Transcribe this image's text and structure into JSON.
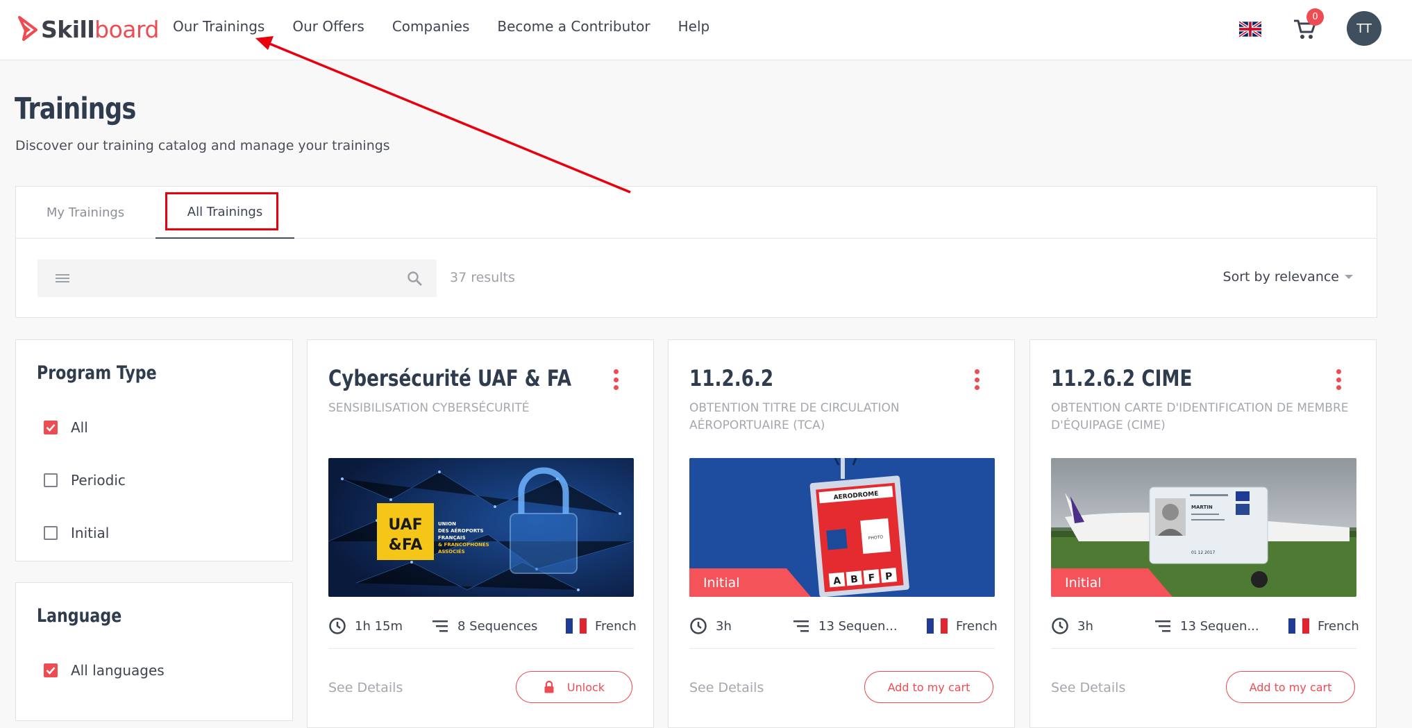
{
  "brand": {
    "name_strong": "Skill",
    "name_light": "board",
    "accent_color": "#ef4b52"
  },
  "nav": {
    "items": [
      "Our Trainings",
      "Our Offers",
      "Companies",
      "Become a Contributor",
      "Help"
    ]
  },
  "header": {
    "language_icon": "uk-flag-icon",
    "cart_count": "0",
    "avatar_initials": "TT"
  },
  "page": {
    "title": "Trainings",
    "subtitle": "Discover our training catalog and manage your trainings"
  },
  "tabs": {
    "my": "My Trainings",
    "all": "All Trainings",
    "active": "all"
  },
  "search": {
    "value": "",
    "placeholder": "",
    "results": "37 results",
    "sort_label": "Sort by relevance"
  },
  "filters": {
    "program_type": {
      "title": "Program Type",
      "options": [
        {
          "label": "All",
          "checked": true
        },
        {
          "label": "Periodic",
          "checked": false
        },
        {
          "label": "Initial",
          "checked": false
        }
      ]
    },
    "language": {
      "title": "Language",
      "options": [
        {
          "label": "All languages",
          "checked": true
        }
      ]
    }
  },
  "cards": [
    {
      "title": "Cybersécurité UAF & FA",
      "subtitle": "SENSIBILISATION CYBERSÉCURITÉ",
      "image_text": {
        "logo_line1": "UAF",
        "logo_line2": "&FA",
        "caption1": "UNION",
        "caption2": "DES AÉROPORTS",
        "caption3": "FRANÇAIS",
        "caption4": "& FRANCOPHONES",
        "caption5": "ASSOCIÉS"
      },
      "badge": "",
      "duration": "1h 15m",
      "sequences": "8 Sequences",
      "language": "French",
      "details_label": "See Details",
      "action_label": "Unlock",
      "action_icon": "lock-icon"
    },
    {
      "title": "11.2.6.2",
      "subtitle": "OBTENTION TITRE DE CIRCULATION AÉROPORTUAIRE (TCA)",
      "image_text": {
        "badge_header": "AERODROME",
        "photo": "PHOTO",
        "letters": [
          "A",
          "B",
          "F",
          "P"
        ]
      },
      "badge": "Initial",
      "duration": "3h",
      "sequences": "13 Sequen...",
      "language": "French",
      "details_label": "See Details",
      "action_label": "Add to my cart",
      "action_icon": ""
    },
    {
      "title": "11.2.6.2 CIME",
      "subtitle": "OBTENTION CARTE D'IDENTIFICATION DE MEMBRE D'ÉQUIPAGE (CIME)",
      "image_text": {
        "card_name": "MARTIN",
        "card_date": "01 12 2017"
      },
      "badge": "Initial",
      "duration": "3h",
      "sequences": "13 Sequen...",
      "language": "French",
      "details_label": "See Details",
      "action_label": "Add to my cart",
      "action_icon": ""
    }
  ],
  "colors": {
    "accent": "#ef4b52",
    "navy": "#2f3c4e",
    "avatar_bg": "#3f4f5e",
    "annotation": "#e8000d"
  }
}
